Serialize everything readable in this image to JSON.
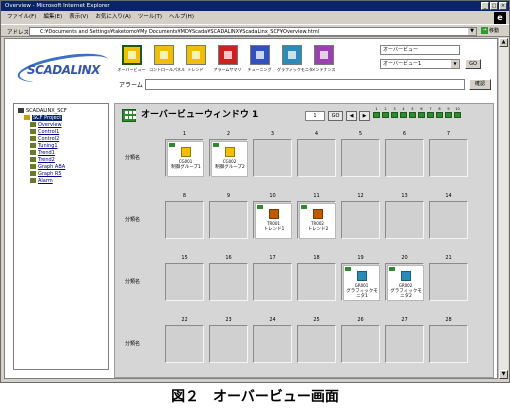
{
  "window": {
    "title": "Overview - Microsoft Internet Explorer",
    "controls": {
      "minimize": "_",
      "maximize": "□",
      "close": "×"
    }
  },
  "menubar": [
    "ファイル(F)",
    "編集(E)",
    "表示(V)",
    "お気に入り(A)",
    "ツール(T)",
    "ヘルプ(H)"
  ],
  "addressbar": {
    "label": "アドレス(D)",
    "value": "C:¥Documents and Settings¥taketomo¥My Documents¥MD¥Scada¥SCADALINX¥ScadaLinx_SCF¥Overview.html",
    "go_label": "移動"
  },
  "app": {
    "logo_text": "SCADALINX",
    "tools": [
      {
        "label": "オーバービュー",
        "icon": "overview-grid-icon",
        "active": true
      },
      {
        "label": "コントロールパネル",
        "icon": "control-panel-icon",
        "active": false
      },
      {
        "label": "トレンド",
        "icon": "trend-icon",
        "active": false
      },
      {
        "label": "アラームサマリ",
        "icon": "alarm-summary-icon",
        "active": false
      },
      {
        "label": "チューニング",
        "icon": "tuning-icon",
        "active": false
      },
      {
        "label": "グラフィックモニタ",
        "icon": "graphic-monitor-icon",
        "active": false
      },
      {
        "label": "メンテナンス",
        "icon": "maintenance-icon",
        "active": false
      }
    ],
    "alarm_label": "アラーム",
    "alarm_value": "",
    "confirm_label": "確認",
    "view_select_top": "オーバービュー",
    "view_select_bottom": "オーバービュー1",
    "view_go_label": "GO"
  },
  "sidebar": {
    "items": [
      {
        "label": "SCADALINX_SCF",
        "level": 0,
        "type": "root",
        "selected": false
      },
      {
        "label": "SCF Project",
        "level": 1,
        "type": "project",
        "selected": true
      },
      {
        "label": "Overview",
        "level": 2,
        "type": "page",
        "selected": false
      },
      {
        "label": "Control1",
        "level": 2,
        "type": "page",
        "selected": false
      },
      {
        "label": "Control2",
        "level": 2,
        "type": "page",
        "selected": false
      },
      {
        "label": "Tuning1",
        "level": 2,
        "type": "page",
        "selected": false
      },
      {
        "label": "Trend1",
        "level": 2,
        "type": "page",
        "selected": false
      },
      {
        "label": "Trend2",
        "level": 2,
        "type": "page",
        "selected": false
      },
      {
        "label": "Graph ABA",
        "level": 2,
        "type": "page",
        "selected": false
      },
      {
        "label": "Graph R5",
        "level": 2,
        "type": "page",
        "selected": false
      },
      {
        "label": "Alarm",
        "level": 2,
        "type": "page",
        "selected": false
      }
    ]
  },
  "overview": {
    "title": "オーバービューウィンドウ 1",
    "page_input": "1",
    "go_label": "GO",
    "prev_icon": "◀",
    "next_icon": "▶",
    "page_indicators": [
      "1",
      "2",
      "3",
      "4",
      "5",
      "6",
      "7",
      "8",
      "9",
      "10"
    ],
    "rows": [
      {
        "label": "分類名",
        "cells": [
          {
            "num": "1",
            "card": {
              "id": "CG001",
              "name": "制御グループ1",
              "kind": "control"
            }
          },
          {
            "num": "2",
            "card": {
              "id": "CG002",
              "name": "制御グループ2",
              "kind": "control"
            }
          },
          {
            "num": "3",
            "card": null
          },
          {
            "num": "4",
            "card": null
          },
          {
            "num": "5",
            "card": null
          },
          {
            "num": "6",
            "card": null
          },
          {
            "num": "7",
            "card": null
          }
        ]
      },
      {
        "label": "分類名",
        "cells": [
          {
            "num": "8",
            "card": null
          },
          {
            "num": "9",
            "card": null
          },
          {
            "num": "10",
            "card": {
              "id": "TR001",
              "name": "トレンド1",
              "kind": "trend"
            }
          },
          {
            "num": "11",
            "card": {
              "id": "TR002",
              "name": "トレンド2",
              "kind": "trend"
            }
          },
          {
            "num": "12",
            "card": null
          },
          {
            "num": "13",
            "card": null
          },
          {
            "num": "14",
            "card": null
          }
        ]
      },
      {
        "label": "分類名",
        "cells": [
          {
            "num": "15",
            "card": null
          },
          {
            "num": "16",
            "card": null
          },
          {
            "num": "17",
            "card": null
          },
          {
            "num": "18",
            "card": null
          },
          {
            "num": "19",
            "card": {
              "id": "GR001",
              "name": "グラフィックモニタ1",
              "kind": "graphic"
            }
          },
          {
            "num": "20",
            "card": {
              "id": "GR002",
              "name": "グラフィックモニタ2",
              "kind": "graphic"
            }
          },
          {
            "num": "21",
            "card": null
          }
        ]
      },
      {
        "label": "分類名",
        "cells": [
          {
            "num": "22",
            "card": null
          },
          {
            "num": "23",
            "card": null
          },
          {
            "num": "24",
            "card": null
          },
          {
            "num": "25",
            "card": null
          },
          {
            "num": "26",
            "card": null
          },
          {
            "num": "27",
            "card": null
          },
          {
            "num": "28",
            "card": null
          }
        ]
      }
    ]
  },
  "caption": "図２　オーバービュー画面",
  "colors": {
    "accent_green": "#2f8a2f",
    "titlebar": "#0a246a",
    "logo_blue": "#3656a8"
  }
}
